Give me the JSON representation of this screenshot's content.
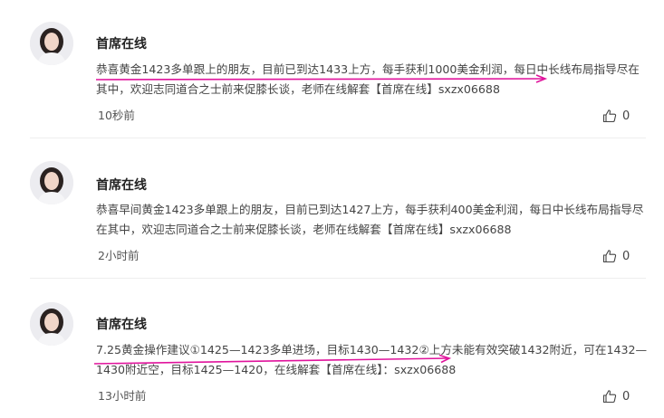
{
  "comments": [
    {
      "author": "首席在线",
      "text": "恭喜黄金1423多单跟上的朋友，目前已到达1433上方，每手获利1000美金利润，每日中长线布局指导尽在其中，欢迎志同道合之士前来促膝长谈，老师在线解套【首席在线】sxzx06688",
      "time": "10秒前",
      "likes": "0"
    },
    {
      "author": "首席在线",
      "text": "恭喜早间黄金1423多单跟上的朋友，目前已到达1427上方，每手获利400美金利润，每日中长线布局指导尽在其中，欢迎志同道合之士前来促膝长谈，老师在线解套【首席在线】sxzx06688",
      "time": "2小时前",
      "likes": "0"
    },
    {
      "author": "首席在线",
      "text": "7.25黄金操作建议①1425—1423多单进场，目标1430—1432②上方未能有效突破1432附近，可在1432—1430附近空，目标1425—1420，在线解套【首席在线】：sxzx06688",
      "time": "13小时前",
      "likes": "0"
    }
  ],
  "colors": {
    "annotation": "#e0139c",
    "author": "#222222",
    "text": "#444444",
    "divider": "#eeeeee"
  },
  "icons": {
    "like": "thumbs-up-icon",
    "avatar": "avatar-portrait"
  }
}
